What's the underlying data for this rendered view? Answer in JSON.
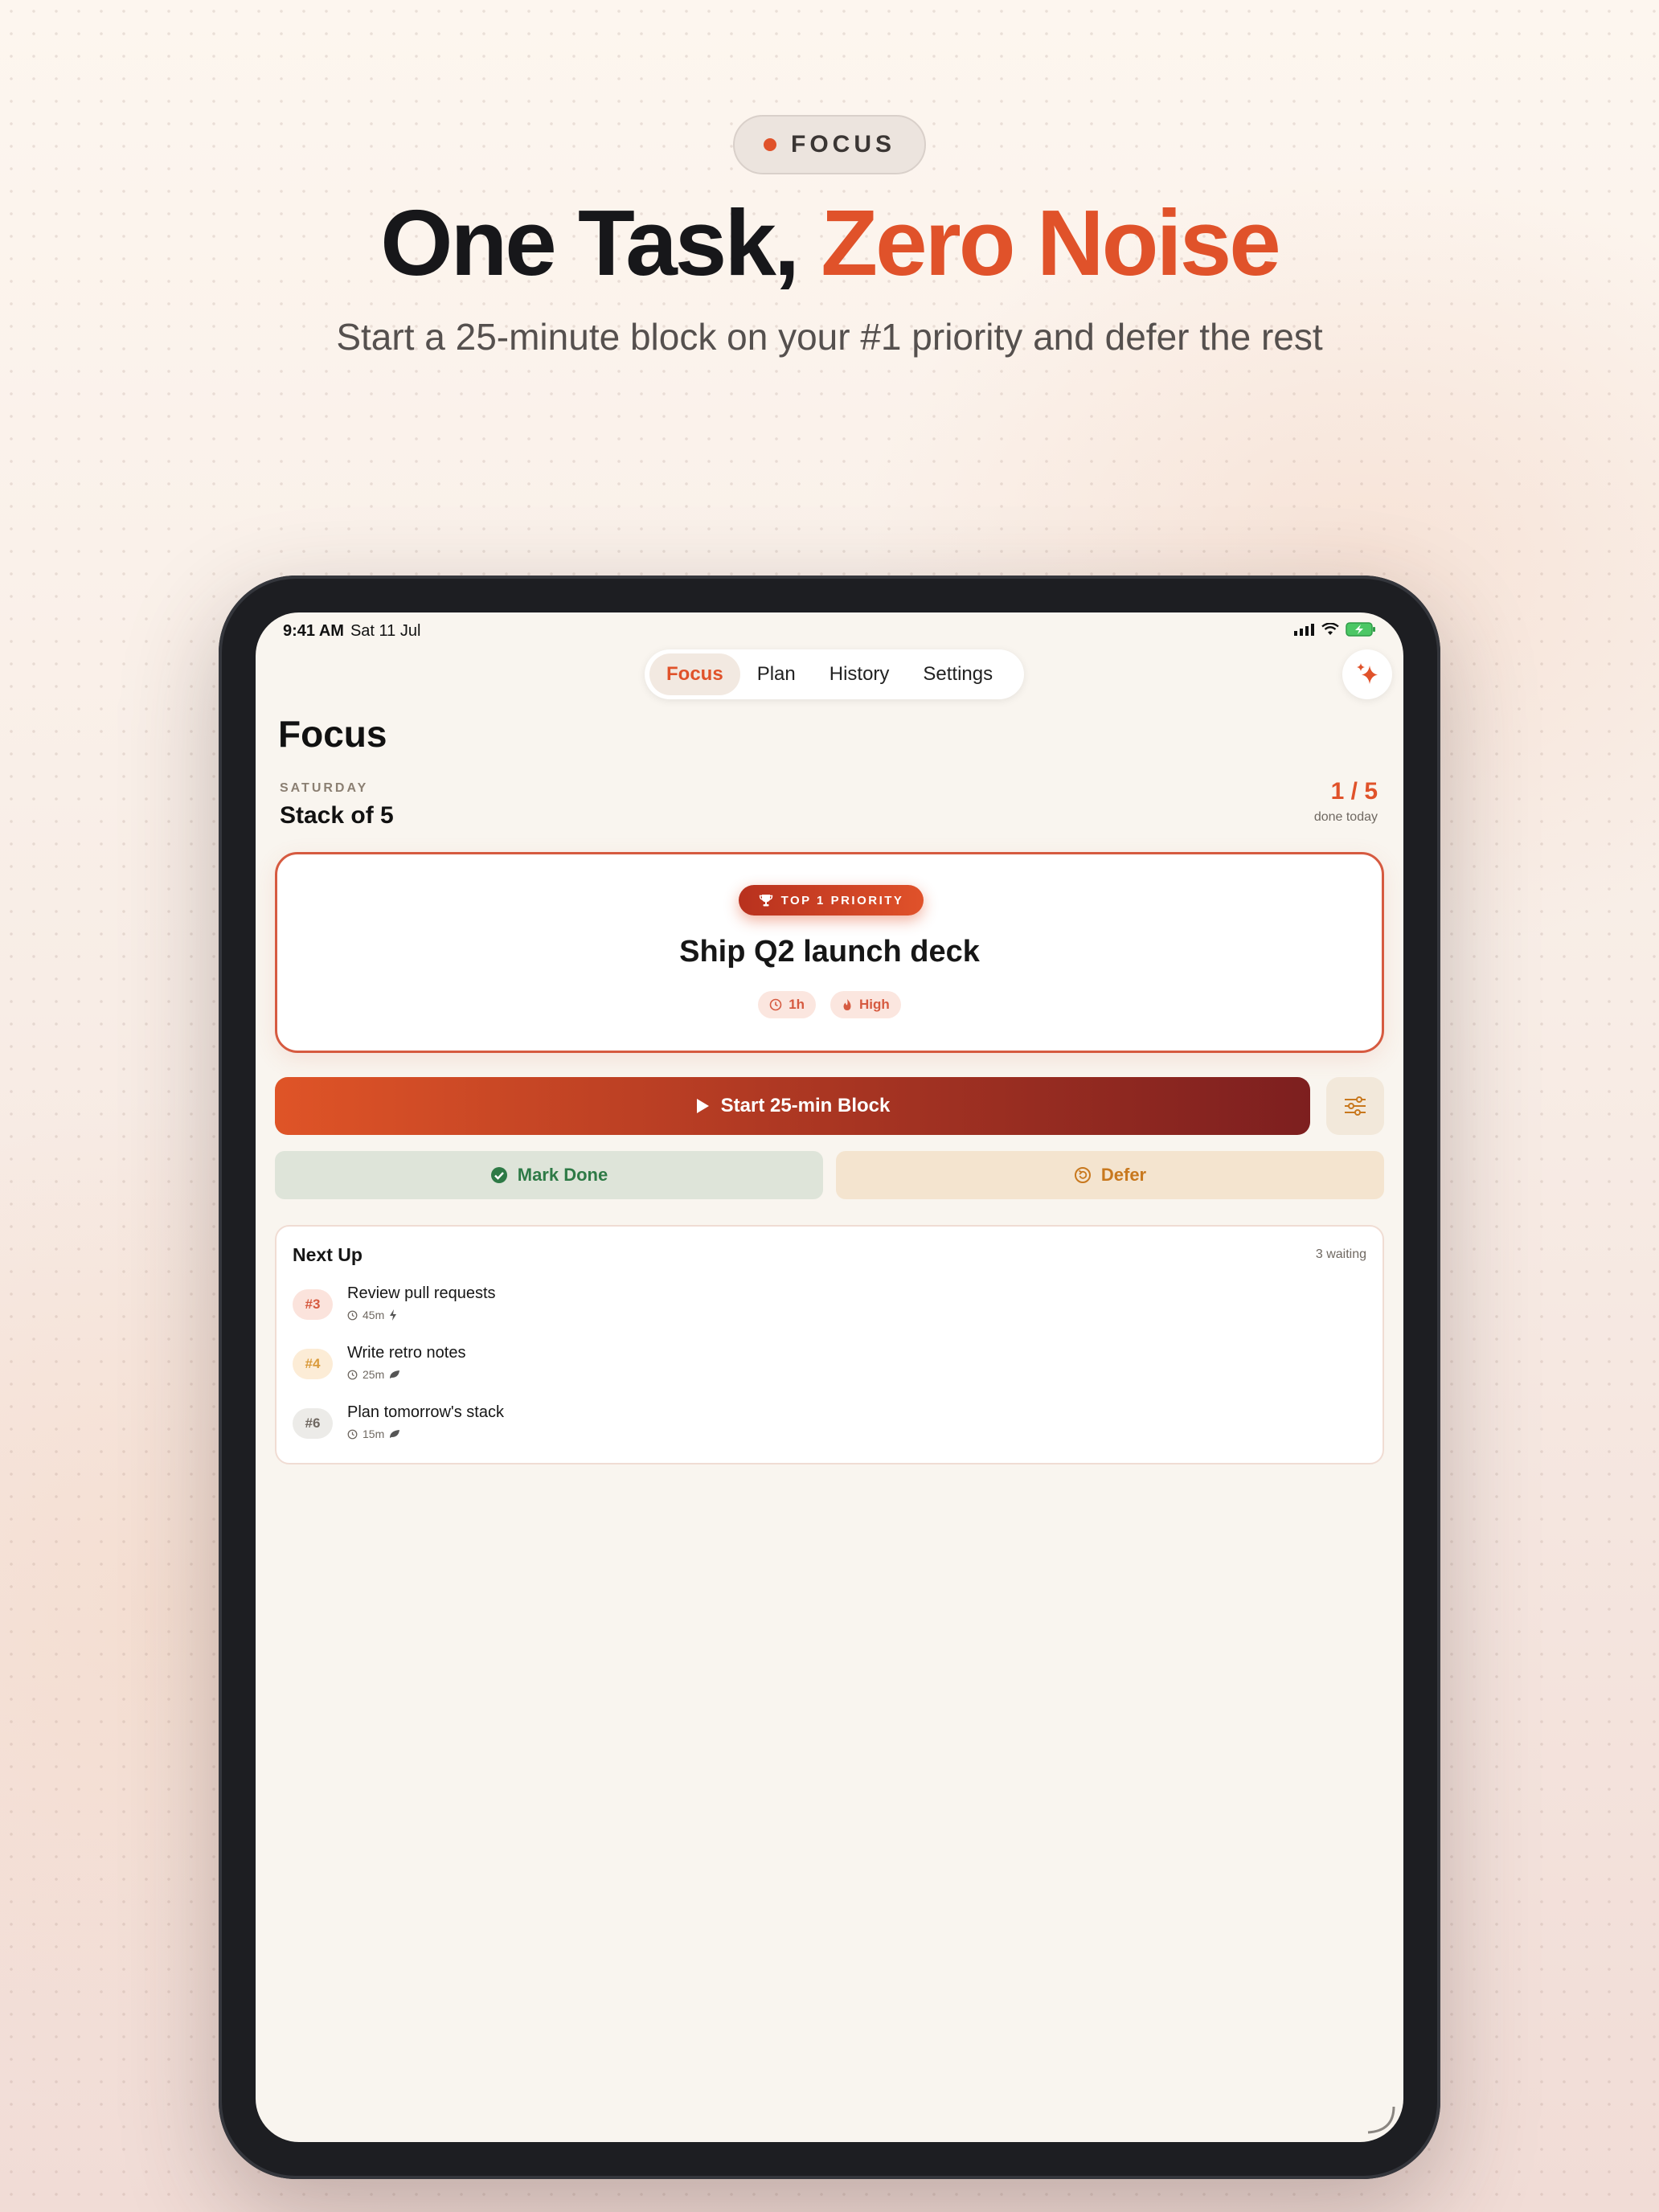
{
  "marketing": {
    "pill_label": "FOCUS",
    "headline_plain": "One Task, ",
    "headline_accent": "Zero Noise",
    "subhead": "Start a 25-minute block on your #1 priority and defer the rest"
  },
  "status_bar": {
    "time": "9:41 AM",
    "date": "Sat 11 Jul"
  },
  "nav": {
    "tabs": [
      {
        "label": "Focus",
        "active": true
      },
      {
        "label": "Plan",
        "active": false
      },
      {
        "label": "History",
        "active": false
      },
      {
        "label": "Settings",
        "active": false
      }
    ],
    "assistant_icon": "sparkle-icon"
  },
  "page": {
    "title": "Focus",
    "day": "SATURDAY",
    "stack": "Stack of 5",
    "done_count": "1 / 5",
    "done_label": "done today"
  },
  "priority": {
    "badge": "TOP 1 PRIORITY",
    "title": "Ship Q2 launch deck",
    "duration": "1h",
    "level": "High"
  },
  "actions": {
    "start": "Start 25-min Block",
    "mark_done": "Mark Done",
    "defer": "Defer"
  },
  "next_up": {
    "title": "Next Up",
    "count": "3 waiting",
    "items": [
      {
        "num": "#3",
        "title": "Review pull requests",
        "duration": "45m",
        "icon": "bolt-icon"
      },
      {
        "num": "#4",
        "title": "Write retro notes",
        "duration": "25m",
        "icon": "leaf-icon"
      },
      {
        "num": "#6",
        "title": "Plan tomorrow's stack",
        "duration": "15m",
        "icon": "leaf-icon"
      }
    ]
  },
  "colors": {
    "accent": "#e0522a",
    "accent_dark": "#7d1f1f",
    "done_green": "#2e7a46",
    "defer_amber": "#c8781e",
    "background": "#f9f5ef"
  }
}
